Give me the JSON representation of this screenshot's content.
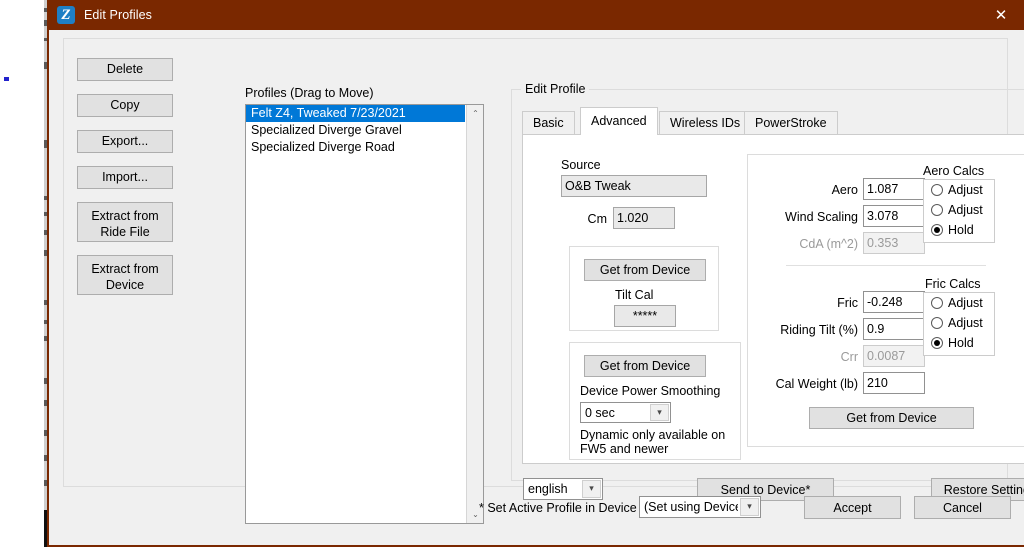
{
  "window": {
    "title": "Edit Profiles",
    "icon": "app-icon",
    "close_label": "✕",
    "titlebar_color": "#7a2800",
    "accent_color": "#0078d7"
  },
  "left_buttons": [
    {
      "label": "Delete",
      "tall": false
    },
    {
      "label": "Copy",
      "tall": false
    },
    {
      "label": "Export...",
      "tall": false
    },
    {
      "label": "Import...",
      "tall": false
    },
    {
      "label": "Extract from\nRide File",
      "tall": true
    },
    {
      "label": "Extract from\nDevice",
      "tall": true
    }
  ],
  "profiles": {
    "label": "Profiles (Drag to Move)",
    "items": [
      {
        "name": "Felt Z4, Tweaked 7/23/2021",
        "selected": true
      },
      {
        "name": "Specialized Diverge Gravel",
        "selected": false
      },
      {
        "name": "Specialized Diverge Road",
        "selected": false
      }
    ],
    "scroll_up": "⌃",
    "scroll_down": "⌄"
  },
  "edit_profile": {
    "legend": "Edit Profile",
    "tabs": [
      {
        "label": "Basic",
        "active": false
      },
      {
        "label": "Advanced",
        "active": true
      },
      {
        "label": "Wireless IDs",
        "active": false
      },
      {
        "label": "PowerStroke",
        "active": false
      }
    ],
    "source": {
      "label": "Source",
      "value": "O&B Tweak"
    },
    "cm": {
      "label": "Cm",
      "value": "1.020"
    },
    "tilt_panel": {
      "get_from_device": "Get from Device",
      "tilt_cal_label": "Tilt Cal",
      "tilt_cal_value": "*****"
    },
    "smoothing_panel": {
      "get_from_device": "Get from Device",
      "label": "Device Power Smoothing",
      "selected": "0 sec",
      "note": "Dynamic only available on\nFW5 and newer"
    },
    "aero_calcs": {
      "title": "Aero Calcs",
      "fields": [
        {
          "label": "Aero",
          "value": "1.087",
          "disabled": false
        },
        {
          "label": "Wind Scaling",
          "value": "3.078",
          "disabled": false
        },
        {
          "label": "CdA (m^2)",
          "value": "0.353",
          "disabled": true
        }
      ],
      "options": [
        {
          "label": "Adjust",
          "selected": false
        },
        {
          "label": "Adjust",
          "selected": false
        },
        {
          "label": "Hold",
          "selected": true
        }
      ]
    },
    "fric_calcs": {
      "title": "Fric Calcs",
      "fields": [
        {
          "label": "Fric",
          "value": "-0.248",
          "disabled": false
        },
        {
          "label": "Riding Tilt (%)",
          "value": "0.9",
          "disabled": false
        },
        {
          "label": "Crr",
          "value": "0.0087",
          "disabled": true
        },
        {
          "label": "Cal Weight (lb)",
          "value": "210",
          "disabled": false
        }
      ],
      "options": [
        {
          "label": "Adjust",
          "selected": false
        },
        {
          "label": "Adjust",
          "selected": false
        },
        {
          "label": "Hold",
          "selected": true
        }
      ],
      "get_from_device": "Get from Device"
    },
    "language": {
      "selected": "english"
    },
    "send_to_device": "Send to Device*",
    "restore_settings": "Restore Settings"
  },
  "footer": {
    "active_profile_label": "* Set Active Profile in Device",
    "active_profile_value": "(Set using Device)",
    "accept": "Accept",
    "cancel": "Cancel"
  }
}
